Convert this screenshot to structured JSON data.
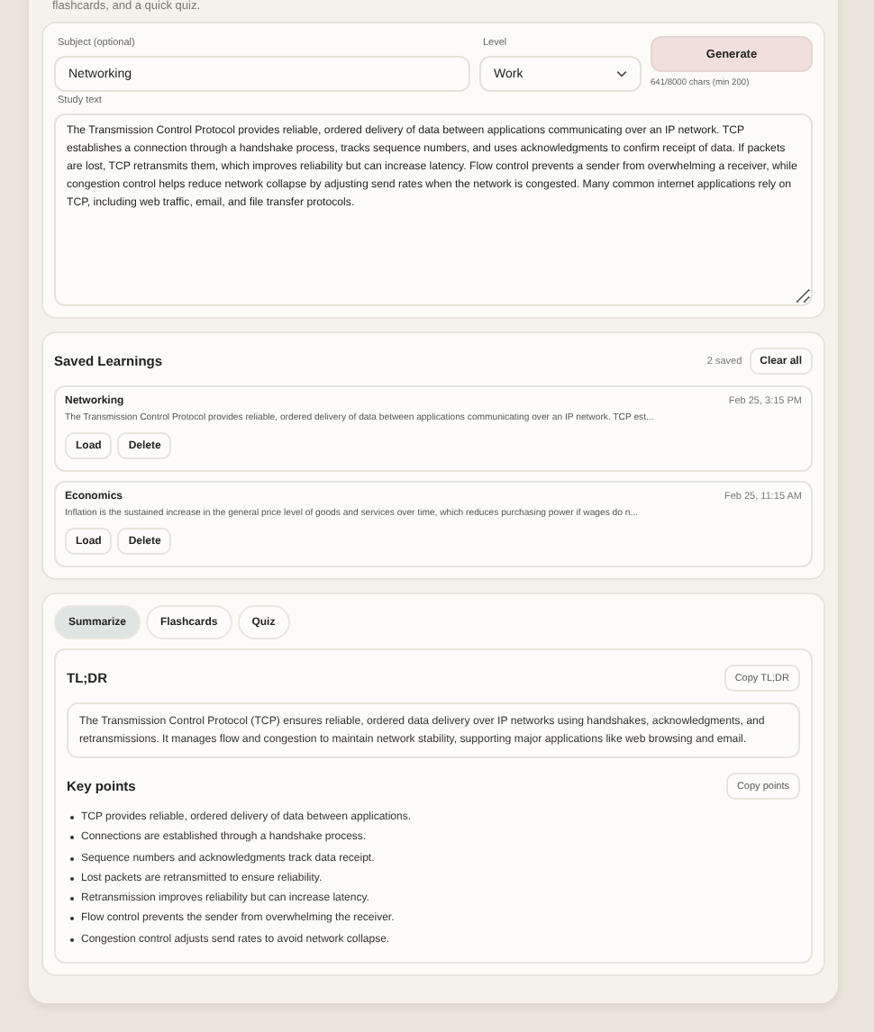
{
  "intro": "flashcards, and a quick quiz.",
  "form": {
    "subject": {
      "label": "Subject (optional)",
      "value": "Networking"
    },
    "level": {
      "label": "Level",
      "value": "Work"
    },
    "generate": "Generate",
    "char_count": "641/8000 chars (min 200)",
    "study_text": {
      "label": "Study text",
      "value": "The Transmission Control Protocol provides reliable, ordered delivery of data between applications communicating over an IP network. TCP establishes a connection through a handshake process, tracks sequence numbers, and uses acknowledgments to confirm receipt of data. If packets are lost, TCP retransmits them, which improves reliability but can increase latency. Flow control prevents a sender from overwhelming a receiver, while congestion control helps reduce network collapse by adjusting send rates when the network is congested. Many common internet applications rely on TCP, including web traffic, email, and file transfer protocols."
    }
  },
  "saved": {
    "title": "Saved Learnings",
    "count": "2 saved",
    "clear": "Clear all",
    "items": [
      {
        "subject": "Networking",
        "time": "Feb 25, 3:15 PM",
        "preview": "The Transmission Control Protocol provides reliable, ordered delivery of data between applications communicating over an IP network. TCP est...",
        "actions": [
          "Load",
          "Delete"
        ]
      },
      {
        "subject": "Economics",
        "time": "Feb 25, 11:15 AM",
        "preview": "Inflation is the sustained increase in the general price level of goods and services over time, which reduces purchasing power if wages do n...",
        "actions": [
          "Load",
          "Delete"
        ]
      }
    ]
  },
  "tabs": [
    {
      "label": "Summarize",
      "selected": true
    },
    {
      "label": "Flashcards",
      "selected": false
    },
    {
      "label": "Quiz",
      "selected": false
    }
  ],
  "summary": {
    "tldr": {
      "title": "TL;DR",
      "copy": "Copy TL;DR",
      "text": "The Transmission Control Protocol (TCP) ensures reliable, ordered data delivery over IP networks using handshakes, acknowledgments, and retransmissions. It manages flow and congestion to maintain network stability, supporting major applications like web browsing and email."
    },
    "key_points": {
      "title": "Key points",
      "copy": "Copy points",
      "items": [
        "TCP provides reliable, ordered delivery of data between applications.",
        "Connections are established through a handshake process.",
        "Sequence numbers and acknowledgments track data receipt.",
        "Lost packets are retransmitted to ensure reliability.",
        "Retransmission improves reliability but can increase latency.",
        "Flow control prevents the sender from overwhelming the receiver.",
        "Congestion control adjusts send rates to avoid network collapse."
      ]
    }
  }
}
